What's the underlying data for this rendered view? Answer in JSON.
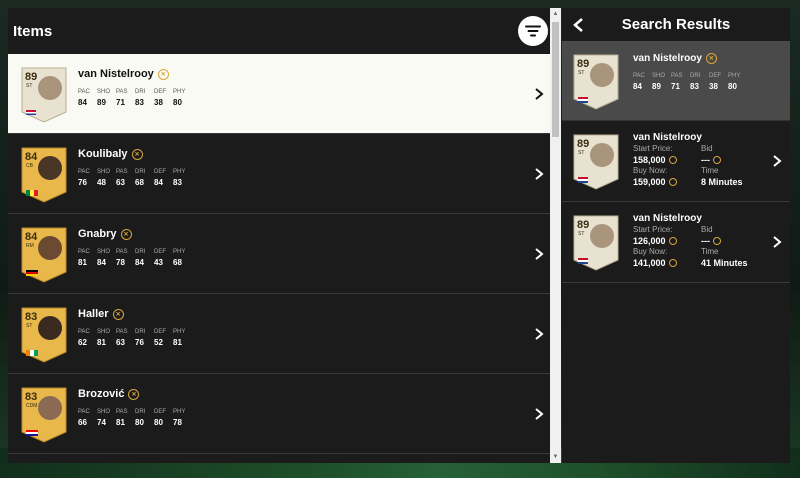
{
  "items_panel": {
    "title": "Items",
    "players": [
      {
        "name": "van Nistelrooy",
        "rating": "89",
        "position": "ST",
        "card": "icon",
        "selected": true,
        "stats": [
          {
            "l": "PAC",
            "v": "84"
          },
          {
            "l": "SHO",
            "v": "89"
          },
          {
            "l": "PAS",
            "v": "71"
          },
          {
            "l": "DRI",
            "v": "83"
          },
          {
            "l": "DEF",
            "v": "38"
          },
          {
            "l": "PHY",
            "v": "80"
          }
        ]
      },
      {
        "name": "Koulibaly",
        "rating": "84",
        "position": "CB",
        "card": "gold",
        "stats": [
          {
            "l": "PAC",
            "v": "76"
          },
          {
            "l": "SHO",
            "v": "48"
          },
          {
            "l": "PAS",
            "v": "63"
          },
          {
            "l": "DRI",
            "v": "68"
          },
          {
            "l": "DEF",
            "v": "84"
          },
          {
            "l": "PHY",
            "v": "83"
          }
        ]
      },
      {
        "name": "Gnabry",
        "rating": "84",
        "position": "RM",
        "card": "gold",
        "stats": [
          {
            "l": "PAC",
            "v": "81"
          },
          {
            "l": "SHO",
            "v": "84"
          },
          {
            "l": "PAS",
            "v": "78"
          },
          {
            "l": "DRI",
            "v": "84"
          },
          {
            "l": "DEF",
            "v": "43"
          },
          {
            "l": "PHY",
            "v": "68"
          }
        ]
      },
      {
        "name": "Haller",
        "rating": "83",
        "position": "ST",
        "card": "gold",
        "stats": [
          {
            "l": "PAC",
            "v": "62"
          },
          {
            "l": "SHO",
            "v": "81"
          },
          {
            "l": "PAS",
            "v": "63"
          },
          {
            "l": "DRI",
            "v": "76"
          },
          {
            "l": "DEF",
            "v": "52"
          },
          {
            "l": "PHY",
            "v": "81"
          }
        ]
      },
      {
        "name": "Brozović",
        "rating": "83",
        "position": "CDM",
        "card": "gold",
        "stats": [
          {
            "l": "PAC",
            "v": "66"
          },
          {
            "l": "SHO",
            "v": "74"
          },
          {
            "l": "PAS",
            "v": "81"
          },
          {
            "l": "DRI",
            "v": "80"
          },
          {
            "l": "DEF",
            "v": "80"
          },
          {
            "l": "PHY",
            "v": "78"
          }
        ]
      }
    ]
  },
  "results_panel": {
    "title": "Search Results",
    "summary": {
      "name": "van Nistelrooy",
      "rating": "89",
      "position": "ST",
      "stats": [
        {
          "l": "PAC",
          "v": "84"
        },
        {
          "l": "SHO",
          "v": "89"
        },
        {
          "l": "PAS",
          "v": "71"
        },
        {
          "l": "DRI",
          "v": "83"
        },
        {
          "l": "DEF",
          "v": "38"
        },
        {
          "l": "PHY",
          "v": "80"
        }
      ]
    },
    "listings": [
      {
        "name": "van Nistelrooy",
        "rating": "89",
        "position": "ST",
        "start_label": "Start Price:",
        "start": "158,000",
        "bid_label": "Bid",
        "bid": "---",
        "buy_label": "Buy Now:",
        "buy": "159,000",
        "time_label": "Time",
        "time": "8 Minutes"
      },
      {
        "name": "van Nistelrooy",
        "rating": "89",
        "position": "ST",
        "start_label": "Start Price:",
        "start": "126,000",
        "bid_label": "Bid",
        "bid": "---",
        "buy_label": "Buy Now:",
        "buy": "141,000",
        "time_label": "Time",
        "time": "41 Minutes"
      }
    ]
  },
  "colors": {
    "card_icon": "#e8e2d0",
    "card_gold": "#e8b84a",
    "coin": "#d8a63a",
    "selected_row": "#fafaf5"
  },
  "icons": {
    "filter": "filter-icon",
    "back": "chevron-left-icon",
    "row": "chevron-right-icon",
    "chemistry": "chemistry-icon",
    "coin": "coin-icon"
  }
}
